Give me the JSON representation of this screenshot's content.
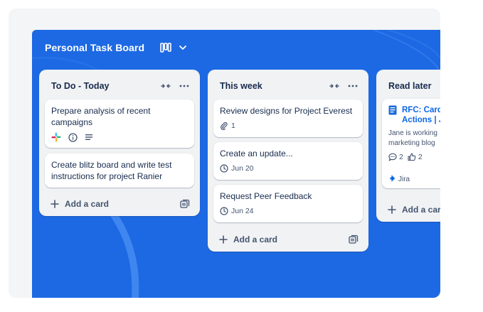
{
  "board": {
    "title": "Personal Task Board",
    "background_color": "#1d69e3",
    "view_icon": "board-columns-icon",
    "chevron_icon": "chevron-down-icon"
  },
  "lists": [
    {
      "title": "To Do - Today",
      "cards": [
        {
          "title": "Prepare analysis of recent campaigns",
          "badges": [
            "slack-icon",
            "info-icon",
            "description-icon"
          ]
        },
        {
          "title": "Create blitz board and write test instructions for project Ranier",
          "badges": []
        }
      ],
      "add_label": "Add a card"
    },
    {
      "title": "This week",
      "cards": [
        {
          "title": "Review designs for Project Everest",
          "attachments": "1"
        },
        {
          "title": "Create an update...",
          "due": "Jun 20"
        },
        {
          "title": "Request Peer Feedback",
          "due": "Jun 24"
        }
      ],
      "add_label": "Add a card"
    },
    {
      "title": "Read later",
      "cards": [
        {
          "title_line1": "RFC: Card",
          "title_line2": "Actions | J",
          "desc_line1": "Jane is working",
          "desc_line2": "marketing blog",
          "comments": "2",
          "votes": "2",
          "source": "Jira"
        }
      ],
      "add_label": "Add a card"
    }
  ]
}
